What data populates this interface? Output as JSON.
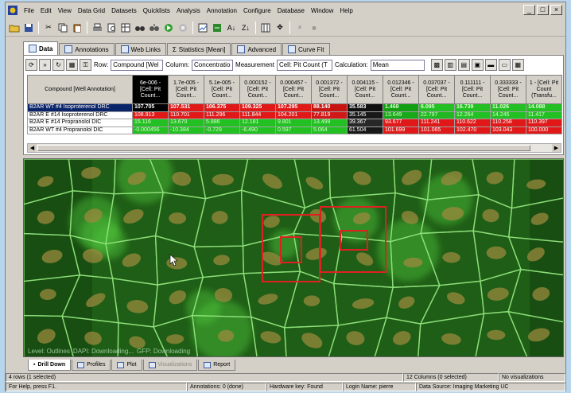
{
  "menu": [
    "File",
    "Edit",
    "View",
    "Data Grid",
    "Datasets",
    "Quicklists",
    "Analysis",
    "Annotation",
    "Configure",
    "Database",
    "Window",
    "Help"
  ],
  "window_controls": [
    "_",
    "□",
    "×"
  ],
  "tabs_top": [
    {
      "label": "Data",
      "icon": "data-grid-icon"
    },
    {
      "label": "Annotations",
      "icon": "annotations-icon"
    },
    {
      "label": "Web Links",
      "icon": "web-links-icon"
    },
    {
      "label": "Statistics [Mean]",
      "icon": "sigma-icon"
    },
    {
      "label": "Advanced",
      "icon": "advanced-icon"
    },
    {
      "label": "Curve Fit",
      "icon": "curve-fit-icon"
    }
  ],
  "controls": {
    "row_label": "Row:",
    "row_value": "Compound [Wel",
    "column_label": "Column:",
    "column_value": "Concentratio",
    "measurement_label": "Measurement",
    "measurement_value": "Cell: Pit Count (T",
    "calculation_label": "Calculation:",
    "calculation_value": "Mean"
  },
  "grid": {
    "row_header": "Compound [Well Annotation]",
    "columns": [
      "6e-006 - [Cell: Pit Count...",
      "1.7e-005 - [Cell: Pit Count...",
      "5.1e-005 - [Cell: Pit Count...",
      "0.000152 - [Cell: Pit Count...",
      "0.000457 - [Cell: Pit Count...",
      "0.001372 - [Cell: Pit Count...",
      "0.004115 - [Cell: Pit Count...",
      "0.012346 - [Cell: Pit Count...",
      "0.037037 - [Cell: Pit Count...",
      "0.111111 - [Cell: Pit Count...",
      "0.333333 - [Cell: Pit Count...",
      "1 - [Cell: Pit Count (Transfu..."
    ],
    "rows": [
      {
        "name": "B2AR WT #4 Isoproterenol DRC",
        "selected": true,
        "values": [
          "107.705",
          "107.531",
          "106.375",
          "109.325",
          "107.295",
          "88.140",
          "35.583",
          "1.468",
          "6.095",
          "16.739",
          "11.026",
          "14.088"
        ],
        "colors": [
          "#000000",
          "#e01818",
          "#e01818",
          "#e01818",
          "#e01818",
          "#c81410",
          "#101010",
          "#12a012",
          "#22c022",
          "#22c022",
          "#22c022",
          "#22c022"
        ]
      },
      {
        "name": "B2AR E #14 Isoproterenol DRC",
        "selected": false,
        "values": [
          "108.913",
          "110.701",
          "111.296",
          "111.844",
          "104.201",
          "77.819",
          "35.145",
          "13.649",
          "22.797",
          "12.264",
          "14.245",
          "11.417"
        ],
        "colors": [
          "#e01818",
          "#e01818",
          "#e01818",
          "#e01818",
          "#e01818",
          "#d01818",
          "#181818",
          "#18a818",
          "#20b820",
          "#22c022",
          "#22c022",
          "#22c022"
        ]
      },
      {
        "name": "B2AR E #14 Propranolol DIC",
        "selected": false,
        "values": [
          "15.116",
          "13.670",
          "5.886",
          "12.181",
          "9.801",
          "13.499",
          "39.367",
          "93.677",
          "111.241",
          "110.622",
          "110.258",
          "110.397"
        ],
        "colors": [
          "#22c022",
          "#22c022",
          "#22c022",
          "#22c022",
          "#22c022",
          "#22c022",
          "#282828",
          "#e01818",
          "#e01818",
          "#e01818",
          "#e01818",
          "#e01818"
        ]
      },
      {
        "name": "B2AR WT #4 Propranolol DIC",
        "selected": false,
        "values": [
          "-0.000456",
          "-10.384",
          "-0.729",
          "-6.490",
          "0.597",
          "5.064",
          "61.504",
          "101.699",
          "101.065",
          "102.470",
          "103.043",
          "100.000"
        ],
        "colors": [
          "#22c022",
          "#22c022",
          "#22c022",
          "#22c022",
          "#22c022",
          "#22c022",
          "#181818",
          "#e01818",
          "#e01818",
          "#e01818",
          "#e01818",
          "#e01818"
        ]
      }
    ]
  },
  "image_status": [
    "Level: Outlines",
    "DAPI: Downloading...",
    "GFP: Downloading"
  ],
  "tabs_bottom": [
    {
      "label": "Drill Down",
      "active": true,
      "enabled": true
    },
    {
      "label": "Profiles",
      "active": false,
      "enabled": true
    },
    {
      "label": "Plot",
      "active": false,
      "enabled": true
    },
    {
      "label": "Visualizations",
      "active": false,
      "enabled": false
    },
    {
      "label": "Report",
      "active": false,
      "enabled": true
    }
  ],
  "status1": {
    "rows": "4 rows (1 selected)",
    "columns": "12 Columns (0 selected)",
    "visualizations": "No visualizations"
  },
  "status2": {
    "help": "For Help, press F1.",
    "annotations": "Annotations: 0 (done)",
    "hardware": "Hardware key: Found",
    "login": "Login Name: pierre",
    "datasource": "Data Source: Imaging Marketing UC"
  },
  "colors": {
    "highlight": "#0a246a",
    "red_cell": "#e01818",
    "green_cell": "#22c022",
    "selection_box": "#e02020"
  }
}
